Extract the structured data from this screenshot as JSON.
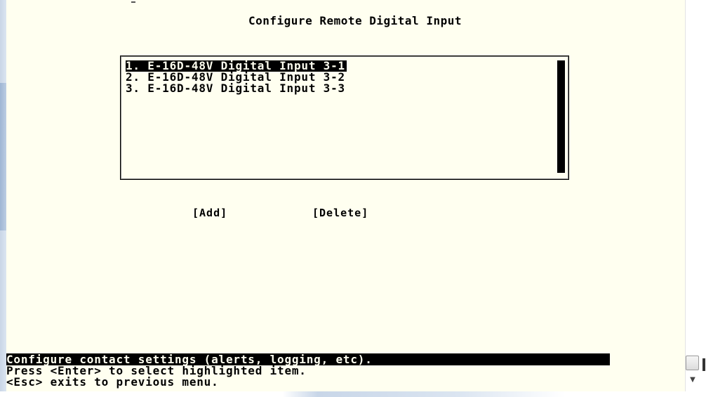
{
  "screen": {
    "title": "Configure Remote Digital Input"
  },
  "list": {
    "items": [
      {
        "label": "1. E-16D-48V Digital Input 3-1",
        "selected": true
      },
      {
        "label": "2. E-16D-48V Digital Input 3-2",
        "selected": false
      },
      {
        "label": "3. E-16D-48V Digital Input 3-3",
        "selected": false
      }
    ]
  },
  "buttons": {
    "add_label": "[Add]",
    "delete_label": "[Delete]"
  },
  "footer": {
    "status": "Configure contact settings (alerts, logging, etc).",
    "help_enter": "Press <Enter> to select highlighted item.",
    "help_esc": "<Esc> exits to previous menu."
  },
  "colors": {
    "terminal_bg": "#fffff0",
    "text": "#000000",
    "highlight_bg": "#000000"
  }
}
